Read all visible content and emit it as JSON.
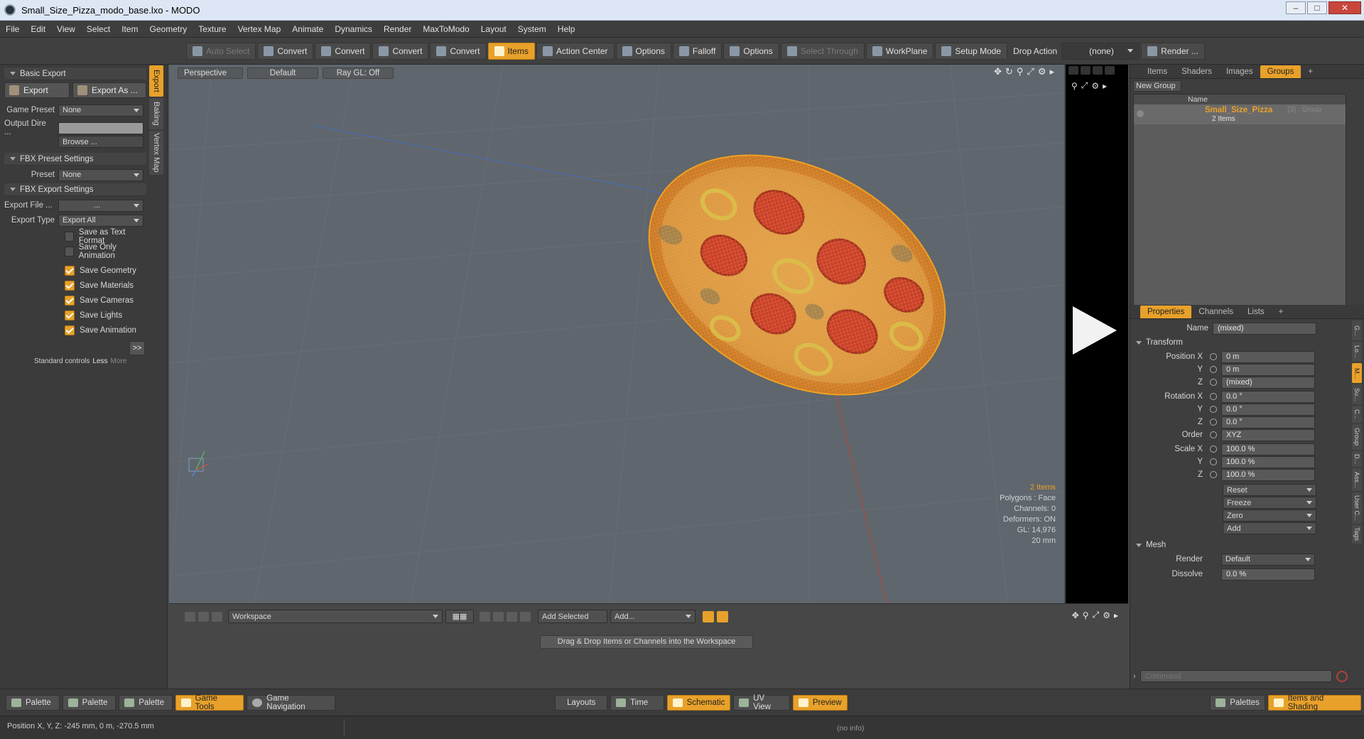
{
  "window": {
    "title": "Small_Size_Pizza_modo_base.lxo - MODO"
  },
  "menu": [
    "File",
    "Edit",
    "View",
    "Select",
    "Item",
    "Geometry",
    "Texture",
    "Vertex Map",
    "Animate",
    "Dynamics",
    "Render",
    "MaxToModo",
    "Layout",
    "System",
    "Help"
  ],
  "toolbar": {
    "auto_select": "Auto Select",
    "convert1": "Convert",
    "convert2": "Convert",
    "convert3": "Convert",
    "convert4": "Convert",
    "items": "Items",
    "action_center": "Action Center",
    "options1": "Options",
    "falloff": "Falloff",
    "options2": "Options",
    "select_through": "Select Through",
    "workplane": "WorkPlane",
    "setup_mode": "Setup Mode",
    "drop_action": "Drop Action",
    "drop_value": "(none)",
    "render": "Render ..."
  },
  "left_tabs": [
    "Export",
    "Baking",
    "Vertex Map"
  ],
  "left": {
    "basic_export": "Basic Export",
    "export_btn": "Export",
    "export_as_btn": "Export As ...",
    "game_preset_label": "Game Preset",
    "game_preset_value": "None",
    "output_dir_label": "Output Dire ...",
    "browse": "Browse ...",
    "fbx_preset_settings": "FBX Preset Settings",
    "preset_label": "Preset",
    "preset_value": "None",
    "fbx_export_settings": "FBX Export Settings",
    "export_file_label": "Export File ...",
    "export_file_value": "...",
    "export_type_label": "Export Type",
    "export_type_value": "Export All",
    "checks_off": [
      "Save as Text Format",
      "Save Only Animation"
    ],
    "checks_on": [
      "Save Geometry",
      "Save Materials",
      "Save Cameras",
      "Save Lights",
      "Save Animation"
    ],
    "more_btn": ">>",
    "std_controls": "Standard controls",
    "less": "Less",
    "more": "More"
  },
  "viewport": {
    "view": "Perspective",
    "style": "Default",
    "raygl": "Ray GL: Off",
    "hud": {
      "items": "2 Items",
      "polygons": "Polygons : Face",
      "channels": "Channels: 0",
      "deformers": "Deformers: ON",
      "gl": "GL: 14,976",
      "size": "20 mm"
    }
  },
  "groups_panel": {
    "tabs": [
      "Items",
      "Shaders",
      "Images",
      "Groups"
    ],
    "new_group": "New Group",
    "col_name": "Name",
    "group_name": "Small_Size_Pizza",
    "group_meta": "(3) : Group",
    "group_count": "2 Items"
  },
  "properties": {
    "tabs": [
      "Properties",
      "Channels",
      "Lists"
    ],
    "name_label": "Name",
    "name_value": "(mixed)",
    "transform": "Transform",
    "pos_x_label": "Position X",
    "pos_x": "0 m",
    "pos_y_label": "Y",
    "pos_y": "0 m",
    "pos_z_label": "Z",
    "pos_z": "(mixed)",
    "rot_x_label": "Rotation X",
    "rot_x": "0.0 °",
    "rot_y_label": "Y",
    "rot_y": "0.0 °",
    "rot_z_label": "Z",
    "rot_z": "0.0 °",
    "order_label": "Order",
    "order": "XYZ",
    "scale_x_label": "Scale X",
    "scale_x": "100.0 %",
    "scale_y_label": "Y",
    "scale_y": "100.0 %",
    "scale_z_label": "Z",
    "scale_z": "100.0 %",
    "reset": "Reset",
    "freeze": "Freeze",
    "zero": "Zero",
    "add": "Add",
    "mesh": "Mesh",
    "render_label": "Render",
    "render_value": "Default",
    "dissolve_label": "Dissolve",
    "dissolve_value": "0.0 %",
    "side_tabs": [
      "G...",
      "Lo...",
      "M...",
      "Su...",
      "C...",
      "Group",
      "D...",
      "Ass...",
      "User C...",
      "Tags"
    ]
  },
  "command": {
    "placeholder": "Command"
  },
  "workspace": {
    "name": "Workspace",
    "add_selected": "Add Selected",
    "add": "Add...",
    "hint": "Drag & Drop Items or Channels into the Workspace"
  },
  "bottom": {
    "left": [
      "Palette",
      "Palette",
      "Palette",
      "Game Tools",
      "Game Navigation"
    ],
    "center": [
      "Layouts",
      "Time",
      "Schematic",
      "UV View",
      "Preview"
    ],
    "right": [
      "Palettes",
      "Items and Shading"
    ]
  },
  "status": {
    "position": "Position X, Y, Z:  -245 mm, 0 m, -270.5 mm",
    "info": "(no info)"
  }
}
